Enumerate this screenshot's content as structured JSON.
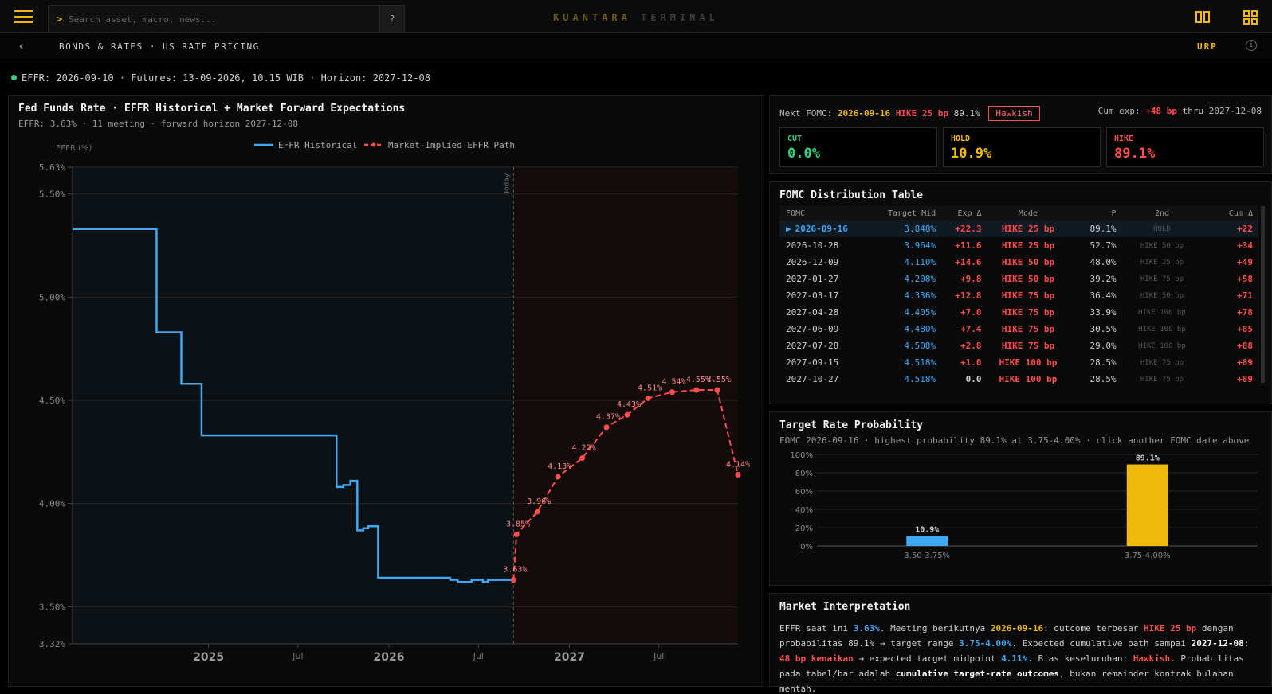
{
  "topbar": {
    "search_prompt": ">",
    "search_placeholder": "Search asset, macro, news...",
    "help_label": "?",
    "brand_primary": "KUANTARA",
    "brand_secondary": "TERMINAL"
  },
  "subbar": {
    "back_icon": "chevron-left-icon",
    "breadcrumb": "BONDS & RATES · US RATE PRICING",
    "code": "URP",
    "info_icon": "info-icon"
  },
  "status": {
    "text": "EFFR: 2026-09-10 · Futures: 13-09-2026, 10.15 WIB · Horizon: 2027-12-08"
  },
  "colors": {
    "accent": "#f0b90b",
    "historical": "#3fa9f5",
    "implied": "#ff4d4d",
    "cut": "#35d07f",
    "hold": "#f0b90b",
    "hike": "#ff4d4d"
  },
  "main_chart": {
    "title": "Fed Funds Rate · EFFR Historical + Market Forward Expectations",
    "subtitle": "EFFR: 3.63% · 11 meeting · forward horizon 2027-12-08",
    "today_label": "Today"
  },
  "chart_data": [
    {
      "type": "line",
      "ylabel": "EFFR (%)",
      "ylim": [
        3.32,
        5.63
      ],
      "yticks": [
        "5.63%",
        "5.50%",
        "5.00%",
        "4.50%",
        "4.00%",
        "3.50%",
        "3.32%"
      ],
      "ytick_values": [
        5.63,
        5.5,
        5.0,
        4.5,
        4.0,
        3.5,
        3.32
      ],
      "xlim": [
        "2024-04-01",
        "2027-12-08"
      ],
      "xticks": [
        {
          "date": "2025-01-01",
          "label": "2025",
          "major": true
        },
        {
          "date": "2025-07-01",
          "label": "Jul",
          "major": false
        },
        {
          "date": "2026-01-01",
          "label": "2026",
          "major": true
        },
        {
          "date": "2026-07-01",
          "label": "Jul",
          "major": false
        },
        {
          "date": "2027-01-01",
          "label": "2027",
          "major": true
        },
        {
          "date": "2027-07-01",
          "label": "Jul",
          "major": false
        }
      ],
      "grid": true,
      "legend_position": "top",
      "today": "2026-09-10",
      "series": [
        {
          "name": "EFFR Historical",
          "style": "step",
          "points": [
            [
              "2024-04-01",
              5.33
            ],
            [
              "2024-04-23",
              5.33
            ],
            [
              "2024-09-18",
              4.83
            ],
            [
              "2024-11-07",
              4.58
            ],
            [
              "2024-12-18",
              4.33
            ],
            [
              "2025-09-17",
              4.33
            ],
            [
              "2025-09-17",
              4.08
            ],
            [
              "2025-10-01",
              4.09
            ],
            [
              "2025-10-15",
              4.11
            ],
            [
              "2025-10-29",
              3.87
            ],
            [
              "2025-11-10",
              3.88
            ],
            [
              "2025-11-20",
              3.89
            ],
            [
              "2025-12-10",
              3.64
            ],
            [
              "2026-05-05",
              3.63
            ],
            [
              "2026-05-20",
              3.62
            ],
            [
              "2026-06-17",
              3.63
            ],
            [
              "2026-07-10",
              3.62
            ],
            [
              "2026-07-20",
              3.63
            ],
            [
              "2026-09-10",
              3.63
            ]
          ]
        },
        {
          "name": "Market-Implied EFFR Path",
          "style": "dashed",
          "points": [
            [
              "2026-09-10",
              3.63
            ],
            [
              "2026-09-16",
              3.85
            ],
            [
              "2026-10-28",
              3.96
            ],
            [
              "2026-12-09",
              4.13
            ],
            [
              "2027-01-27",
              4.22
            ],
            [
              "2027-03-17",
              4.37
            ],
            [
              "2027-04-28",
              4.43
            ],
            [
              "2027-06-09",
              4.51
            ],
            [
              "2027-07-28",
              4.54
            ],
            [
              "2027-09-15",
              4.55
            ],
            [
              "2027-10-27",
              4.55
            ],
            [
              "2027-12-08",
              4.14
            ]
          ],
          "labels": [
            "3.63%",
            "3.85%",
            "3.96%",
            "4.13%",
            "4.22%",
            "4.37%",
            "4.43%",
            "4.51%",
            "4.54%",
            "4.55%",
            "4.55%",
            "4.14%"
          ]
        }
      ]
    },
    {
      "type": "bar",
      "categories": [
        "3.50-3.75%",
        "3.75-4.00%"
      ],
      "values": [
        10.9,
        89.1
      ],
      "data_labels": [
        "10.9%",
        "89.1%"
      ],
      "bar_colors": [
        "#3fa9f5",
        "#f0b90b"
      ],
      "ylim": [
        0,
        100
      ],
      "yticks": [
        "100%",
        "80%",
        "60%",
        "40%",
        "20%",
        "0%"
      ],
      "ytick_values": [
        100,
        80,
        60,
        40,
        20,
        0
      ],
      "grid": true
    }
  ],
  "summary": {
    "next_label": "Next FOMC:",
    "next_date": "2026-09-16",
    "next_action": "HIKE 25 bp",
    "next_prob": "89.1%",
    "badge": "Hawkish",
    "cum_label": "Cum exp:",
    "cum_value": "+48 bp",
    "cum_suffix": "thru 2027-12-08",
    "cards": [
      {
        "label": "CUT",
        "value": "0.0%"
      },
      {
        "label": "HOLD",
        "value": "10.9%"
      },
      {
        "label": "HIKE",
        "value": "89.1%"
      }
    ]
  },
  "table": {
    "title": "FOMC Distribution Table",
    "columns": [
      "FOMC",
      "Target Mid",
      "Exp Δ",
      "Mode",
      "P",
      "2nd",
      "Cum Δ"
    ],
    "selected_marker": "▶",
    "rows": [
      {
        "date": "2026-09-16",
        "mid": "3.848%",
        "exp": "+22.3",
        "mode": "HIKE 25 bp",
        "p": "89.1%",
        "second": "HOLD",
        "cum": "+22"
      },
      {
        "date": "2026-10-28",
        "mid": "3.964%",
        "exp": "+11.6",
        "mode": "HIKE 25 bp",
        "p": "52.7%",
        "second": "HIKE 50 bp",
        "cum": "+34"
      },
      {
        "date": "2026-12-09",
        "mid": "4.110%",
        "exp": "+14.6",
        "mode": "HIKE 50 bp",
        "p": "48.0%",
        "second": "HIKE 25 bp",
        "cum": "+49"
      },
      {
        "date": "2027-01-27",
        "mid": "4.208%",
        "exp": "+9.8",
        "mode": "HIKE 50 bp",
        "p": "39.2%",
        "second": "HIKE 75 bp",
        "cum": "+58"
      },
      {
        "date": "2027-03-17",
        "mid": "4.336%",
        "exp": "+12.8",
        "mode": "HIKE 75 bp",
        "p": "36.4%",
        "second": "HIKE 50 bp",
        "cum": "+71"
      },
      {
        "date": "2027-04-28",
        "mid": "4.405%",
        "exp": "+7.0",
        "mode": "HIKE 75 bp",
        "p": "33.9%",
        "second": "HIKE 100 bp",
        "cum": "+78"
      },
      {
        "date": "2027-06-09",
        "mid": "4.480%",
        "exp": "+7.4",
        "mode": "HIKE 75 bp",
        "p": "30.5%",
        "second": "HIKE 100 bp",
        "cum": "+85"
      },
      {
        "date": "2027-07-28",
        "mid": "4.508%",
        "exp": "+2.8",
        "mode": "HIKE 75 bp",
        "p": "29.0%",
        "second": "HIKE 100 bp",
        "cum": "+88"
      },
      {
        "date": "2027-09-15",
        "mid": "4.518%",
        "exp": "+1.0",
        "mode": "HIKE 100 bp",
        "p": "28.5%",
        "second": "HIKE 75 bp",
        "cum": "+89"
      },
      {
        "date": "2027-10-27",
        "mid": "4.518%",
        "exp": "0.0",
        "mode": "HIKE 100 bp",
        "p": "28.5%",
        "second": "HIKE 75 bp",
        "cum": "+89"
      }
    ]
  },
  "probability": {
    "title": "Target Rate Probability",
    "subtitle": "FOMC 2026-09-16 · highest probability 89.1% at 3.75-4.00% · click another FOMC date above"
  },
  "interpretation": {
    "title": "Market Interpretation",
    "t1": "EFFR saat ini ",
    "v_effr": "3.63%",
    "t2": ". Meeting berikutnya ",
    "v_date": "2026-09-16",
    "t3": ": outcome terbesar ",
    "v_mode": "HIKE 25 bp",
    "t4": " dengan probabilitas 89.1% → target range ",
    "v_range": "3.75-4.00%",
    "t5": ". Expected cumulative path sampai ",
    "v_horizon": "2027-12-08",
    "t6": ": ",
    "v_cum": "48 bp kenaikan",
    "t7": " → expected target midpoint ",
    "v_mid": "4.11%",
    "t8": ". Bias keseluruhan: ",
    "v_bias": "Hawkish.",
    "t9": " Probabilitas pada tabel/bar adalah ",
    "v_cumul": "cumulative target-rate outcomes",
    "t10": ", bukan remainder kontrak bulanan mentah."
  }
}
